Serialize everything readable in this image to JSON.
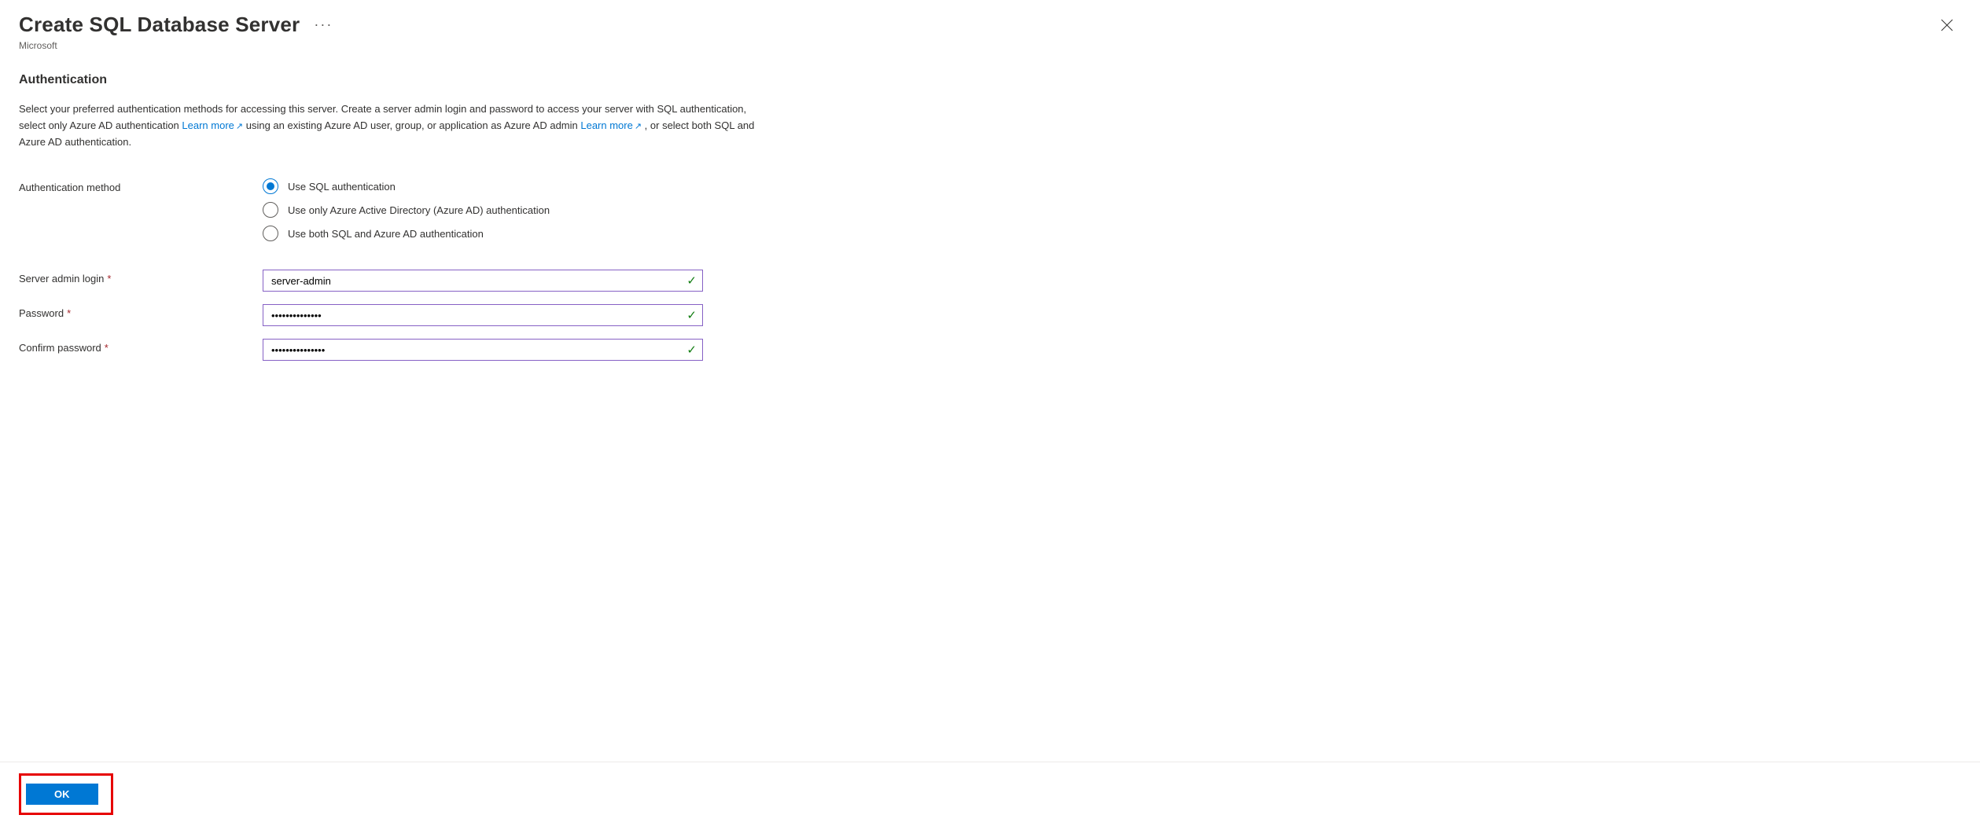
{
  "header": {
    "title": "Create SQL Database Server",
    "subtitle": "Microsoft",
    "more_label": "···"
  },
  "section": {
    "heading": "Authentication",
    "desc_part1": "Select your preferred authentication methods for accessing this server. Create a server admin login and password to access your server with SQL authentication, select only Azure AD authentication ",
    "learn_more1": "Learn more",
    "desc_part2": " using an existing Azure AD user, group, or application as Azure AD admin ",
    "learn_more2": "Learn more",
    "desc_part3": " , or select both SQL and Azure AD authentication."
  },
  "form": {
    "auth_method_label": "Authentication method",
    "radios": {
      "sql": "Use SQL authentication",
      "aad_only": "Use only Azure Active Directory (Azure AD) authentication",
      "both": "Use both SQL and Azure AD authentication"
    },
    "admin_login_label": "Server admin login",
    "admin_login_value": "server-admin",
    "password_label": "Password",
    "password_value": "••••••••••••••",
    "confirm_password_label": "Confirm password",
    "confirm_password_value": "•••••••••••••••",
    "required_mark": "*"
  },
  "footer": {
    "ok_label": "OK"
  }
}
